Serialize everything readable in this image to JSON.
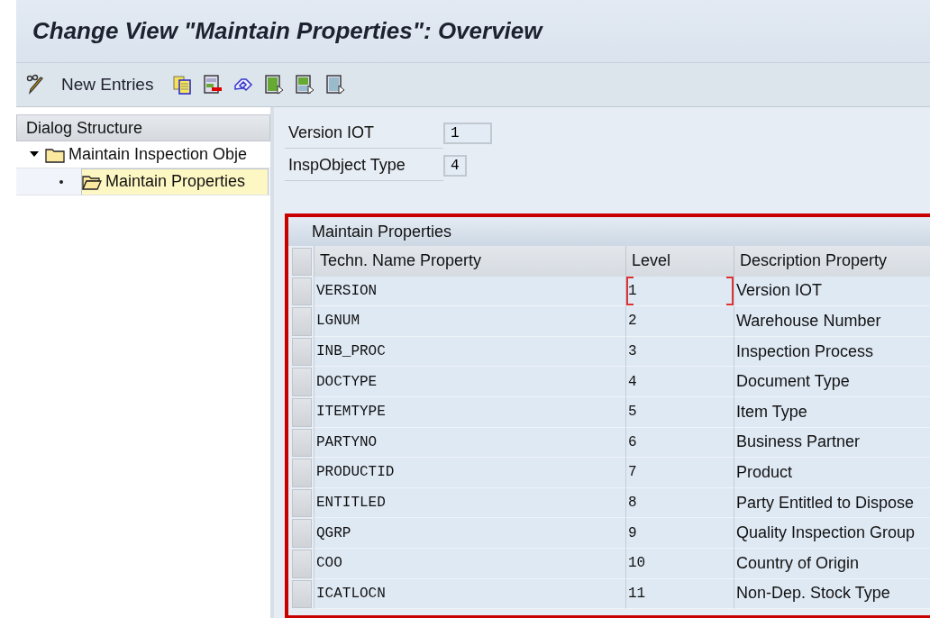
{
  "window": {
    "title": "Change View \"Maintain Properties\": Overview"
  },
  "toolbar": {
    "items": [
      {
        "kind": "pencil"
      },
      {
        "kind": "text",
        "label": "New Entries"
      },
      {
        "kind": "copy"
      },
      {
        "kind": "delete"
      },
      {
        "kind": "undo"
      },
      {
        "kind": "select-all"
      },
      {
        "kind": "select-block"
      },
      {
        "kind": "deselect"
      }
    ]
  },
  "dialog_structure": {
    "title": "Dialog Structure",
    "items": [
      {
        "label": "Maintain Inspection Obje",
        "expanded": true,
        "selected": false,
        "children": [
          {
            "label": "Maintain Properties",
            "selected": true
          }
        ]
      }
    ]
  },
  "header_fields": [
    {
      "label": "Version IOT",
      "value": "1"
    },
    {
      "label": "InspObject Type",
      "value": "4"
    }
  ],
  "table": {
    "title": "Maintain Properties",
    "columns": [
      "Techn. Name Property",
      "Level",
      "Description Property"
    ],
    "rows": [
      {
        "name": "VERSION",
        "level": "1",
        "description": "Version IOT",
        "focused": true
      },
      {
        "name": "LGNUM",
        "level": "2",
        "description": "Warehouse Number",
        "focused": false
      },
      {
        "name": "INB_PROC",
        "level": "3",
        "description": "Inspection Process",
        "focused": false
      },
      {
        "name": "DOCTYPE",
        "level": "4",
        "description": "Document Type",
        "focused": false
      },
      {
        "name": "ITEMTYPE",
        "level": "5",
        "description": "Item Type",
        "focused": false
      },
      {
        "name": "PARTYNO",
        "level": "6",
        "description": "Business Partner",
        "focused": false
      },
      {
        "name": "PRODUCTID",
        "level": "7",
        "description": "Product",
        "focused": false
      },
      {
        "name": "ENTITLED",
        "level": "8",
        "description": "Party Entitled to Dispose",
        "focused": false
      },
      {
        "name": "QGRP",
        "level": "9",
        "description": "Quality Inspection Group",
        "focused": false
      },
      {
        "name": "COO",
        "level": "10",
        "description": "Country of Origin",
        "focused": false
      },
      {
        "name": "ICATLOCN",
        "level": "11",
        "description": "Non-Dep. Stock Type",
        "focused": false
      }
    ]
  }
}
